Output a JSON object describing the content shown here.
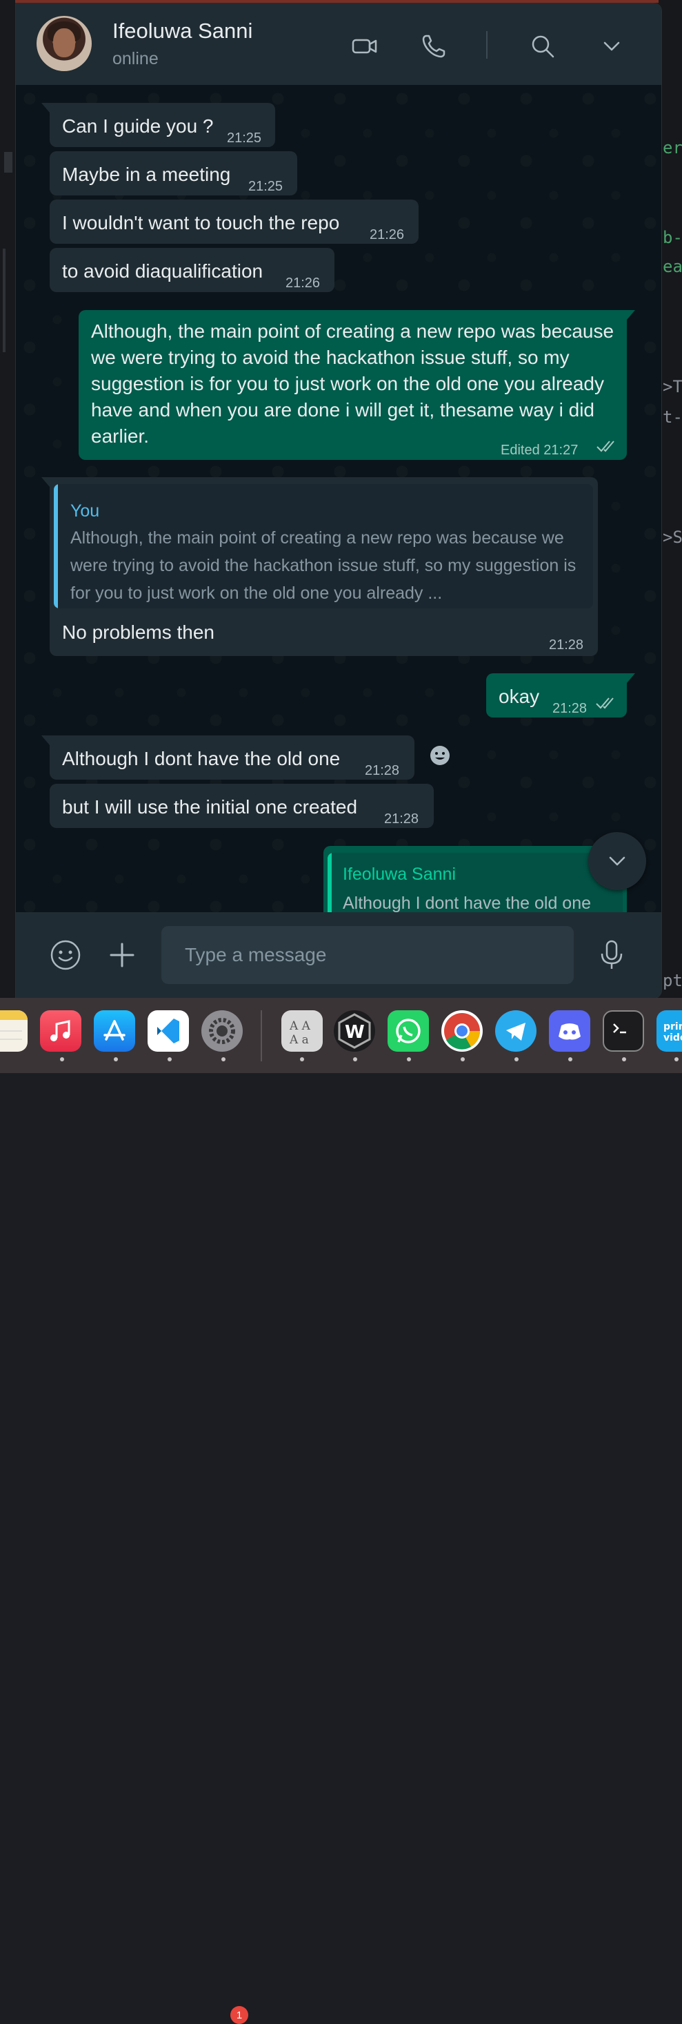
{
  "window": {
    "app": "WhatsApp"
  },
  "header": {
    "contact_name": "Ifeoluwa Sanni",
    "status": "online",
    "icons": [
      "video-call-icon",
      "voice-call-icon",
      "search-icon",
      "chevron-down-icon"
    ]
  },
  "messages": [
    {
      "dir": "in",
      "text": "Can I guide you ?",
      "time": "21:25"
    },
    {
      "dir": "in",
      "text": "Maybe in a meeting",
      "time": "21:25"
    },
    {
      "dir": "in",
      "text": "I wouldn't want to touch the repo",
      "time": "21:26"
    },
    {
      "dir": "in",
      "text": "to avoid diaqualification",
      "time": "21:26"
    },
    {
      "dir": "out",
      "text": "Although, the main point of creating a new repo was because we were trying to avoid the hackathon issue stuff, so my suggestion is for you to just work on the old one you already have and when you are done i will get it, thesame way i did earlier.",
      "meta": "Edited 21:27",
      "ticks": "read"
    },
    {
      "dir": "in",
      "quote_author": "You",
      "quote_text": "Although, the main point of creating a new repo was because we were trying to avoid the hackathon issue stuff, so my suggestion is for you to just work on the old one you already ...",
      "text": "No problems then",
      "time": "21:28"
    },
    {
      "dir": "out",
      "text": "okay",
      "time": "21:28",
      "ticks": "read"
    },
    {
      "dir": "in",
      "text": "Although I dont have the old one",
      "time": "21:28"
    },
    {
      "dir": "in",
      "text": "but I will use the initial one created",
      "time": "21:28"
    },
    {
      "dir": "out",
      "quote_author": "Ifeoluwa Sanni",
      "quote_text": "Although I dont have the old one"
    }
  ],
  "composer": {
    "placeholder": "Type a message"
  },
  "dock": {
    "apps": [
      "Notes",
      "Music",
      "App Store",
      "Visual Studio Code",
      "System Settings",
      "Dictionary",
      "Warp",
      "WhatsApp",
      "Google Chrome",
      "Telegram",
      "Discord",
      "Terminal",
      "Prime Video"
    ],
    "settings_badge": "1"
  },
  "background": {
    "fragments": [
      "er",
      "b-",
      "ea",
      ">T",
      "t-",
      ">S",
      "pt"
    ]
  },
  "colors": {
    "incoming": "#202c33",
    "outgoing": "#005c4b",
    "accent": "#53bdeb",
    "green_accent": "#06cf9c"
  }
}
